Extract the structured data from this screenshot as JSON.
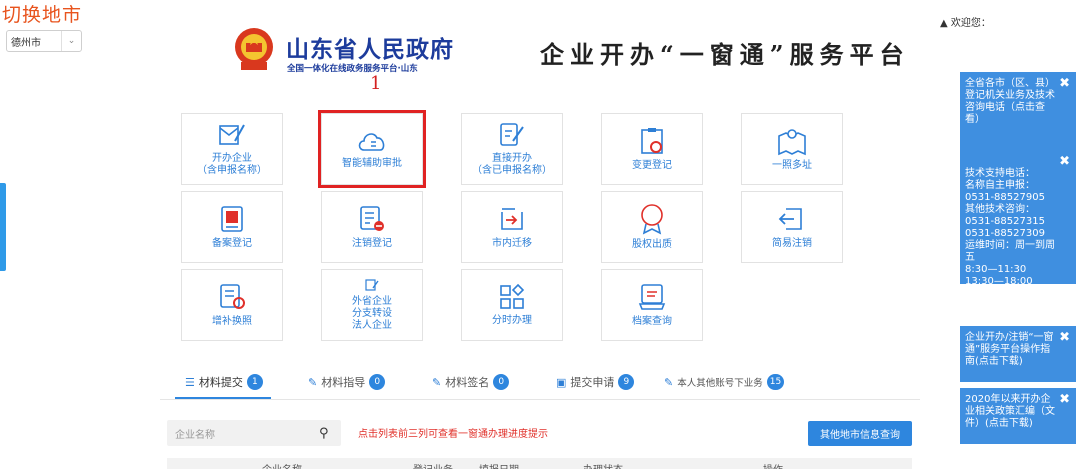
{
  "city": {
    "title": "切换地市",
    "selected": "德州市"
  },
  "header": {
    "gov_name": "山东省人民政府",
    "gov_sub": "全国一体化在线政务服务平台·山东",
    "marker": "1",
    "platform_title": "企业开办“一窗通”服务平台",
    "welcome": "欢迎您："
  },
  "tiles": [
    {
      "label": "开办企业\n（含申报名称）",
      "icon": "register-pen-icon"
    },
    {
      "label": "智能辅助审批",
      "icon": "cloud-icon",
      "highlighted": true
    },
    {
      "label": "直接开办\n（含已申报名称）",
      "icon": "edit-doc-icon"
    },
    {
      "label": "变更登记",
      "icon": "clipboard-refresh-icon"
    },
    {
      "label": "一照多址",
      "icon": "map-pin-icon"
    },
    {
      "label": "备案登记",
      "icon": "star-doc-icon"
    },
    {
      "label": "注销登记",
      "icon": "doc-minus-icon"
    },
    {
      "label": "市内迁移",
      "icon": "move-box-icon"
    },
    {
      "label": "股权出质",
      "icon": "equity-medal-icon"
    },
    {
      "label": "简易注销",
      "icon": "simple-cancel-icon"
    },
    {
      "label": "增补换照",
      "icon": "doc-badge-icon"
    },
    {
      "label": "外省企业\n分支转设\n法人企业",
      "icon": "small-edit-icon"
    },
    {
      "label": "分时办理",
      "icon": "grid-diamond-icon"
    },
    {
      "label": "档案查询",
      "icon": "archive-icon"
    }
  ],
  "side_panels": [
    {
      "text": "全省各市（区、县）登记机关业务及技术咨询电话（点击查看）"
    },
    {
      "text": "技术支持电话：\n名称自主申报：\n0531-88527905\n其他技术咨询：\n0531-88527315\n0531-88527309\n运维时间：周一到周五\n8:30—11:30\n13:30—18:00"
    },
    {
      "text": "企业开办/注销“一窗通”服务平台操作指南(点击下载)"
    },
    {
      "text": "2020年以来开办企业相关政策汇编（文件）(点击下载)"
    }
  ],
  "tabs": [
    {
      "label": "材料提交",
      "count": "1",
      "icon": "list-icon"
    },
    {
      "label": "材料指导",
      "count": "0",
      "icon": "edit-icon"
    },
    {
      "label": "材料签名",
      "count": "0",
      "icon": "edit-icon"
    },
    {
      "label": "提交申请",
      "count": "9",
      "icon": "briefcase-icon"
    },
    {
      "label": "本人其他账号下业务",
      "count": "15",
      "icon": "edit-icon"
    }
  ],
  "search": {
    "placeholder": "企业名称"
  },
  "hint": "点击列表前三列可查看一窗通办理进度提示",
  "query_button": "其他地市信息查询",
  "table_headers": [
    "企业名称",
    "登记业务",
    "填报日期",
    "办理状态",
    "操作"
  ],
  "colors": {
    "accent": "#2e86de",
    "brand_blue": "#1d3c9c",
    "highlight_red": "#e02222",
    "city_orange": "#e8541e"
  }
}
